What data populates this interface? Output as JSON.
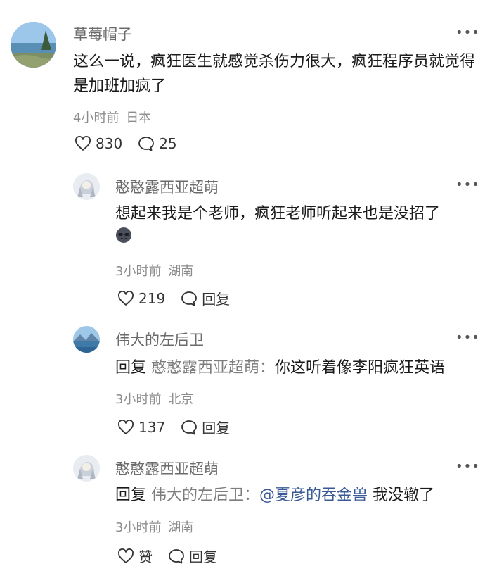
{
  "comments": [
    {
      "username": "草莓帽子",
      "text": "这么一说，疯狂医生就感觉杀伤力很大，疯狂程序员就觉得是加班加疯了",
      "time": "4小时前",
      "location": "日本",
      "likes": "830",
      "replies": "25",
      "avatar_icon": "lake-landscape-avatar"
    },
    {
      "username": "憨憨露西亚超萌",
      "text": "想起来我是个老师，疯狂老师听起来也是没招了",
      "emoji": "sunglasses-face-emoji",
      "time": "3小时前",
      "location": "湖南",
      "likes": "219",
      "reply_label": "回复",
      "avatar_icon": "anime-character-avatar"
    },
    {
      "username": "伟大的左后卫",
      "reply_prefix": "回复",
      "reply_to": "憨憨露西亚超萌",
      "separator": "：",
      "text": "你这听着像李阳疯狂英语",
      "time": "3小时前",
      "location": "北京",
      "likes": "137",
      "reply_label": "回复",
      "avatar_icon": "mountain-lake-avatar"
    },
    {
      "username": "憨憨露西亚超萌",
      "reply_prefix": "回复",
      "reply_to": "伟大的左后卫",
      "separator": "：",
      "mention": "@夏彦的吞金兽",
      "text": " 我没辙了",
      "time": "3小时前",
      "location": "湖南",
      "likes": "赞",
      "reply_label": "回复",
      "avatar_icon": "anime-character-avatar"
    }
  ],
  "more_label": "•••"
}
